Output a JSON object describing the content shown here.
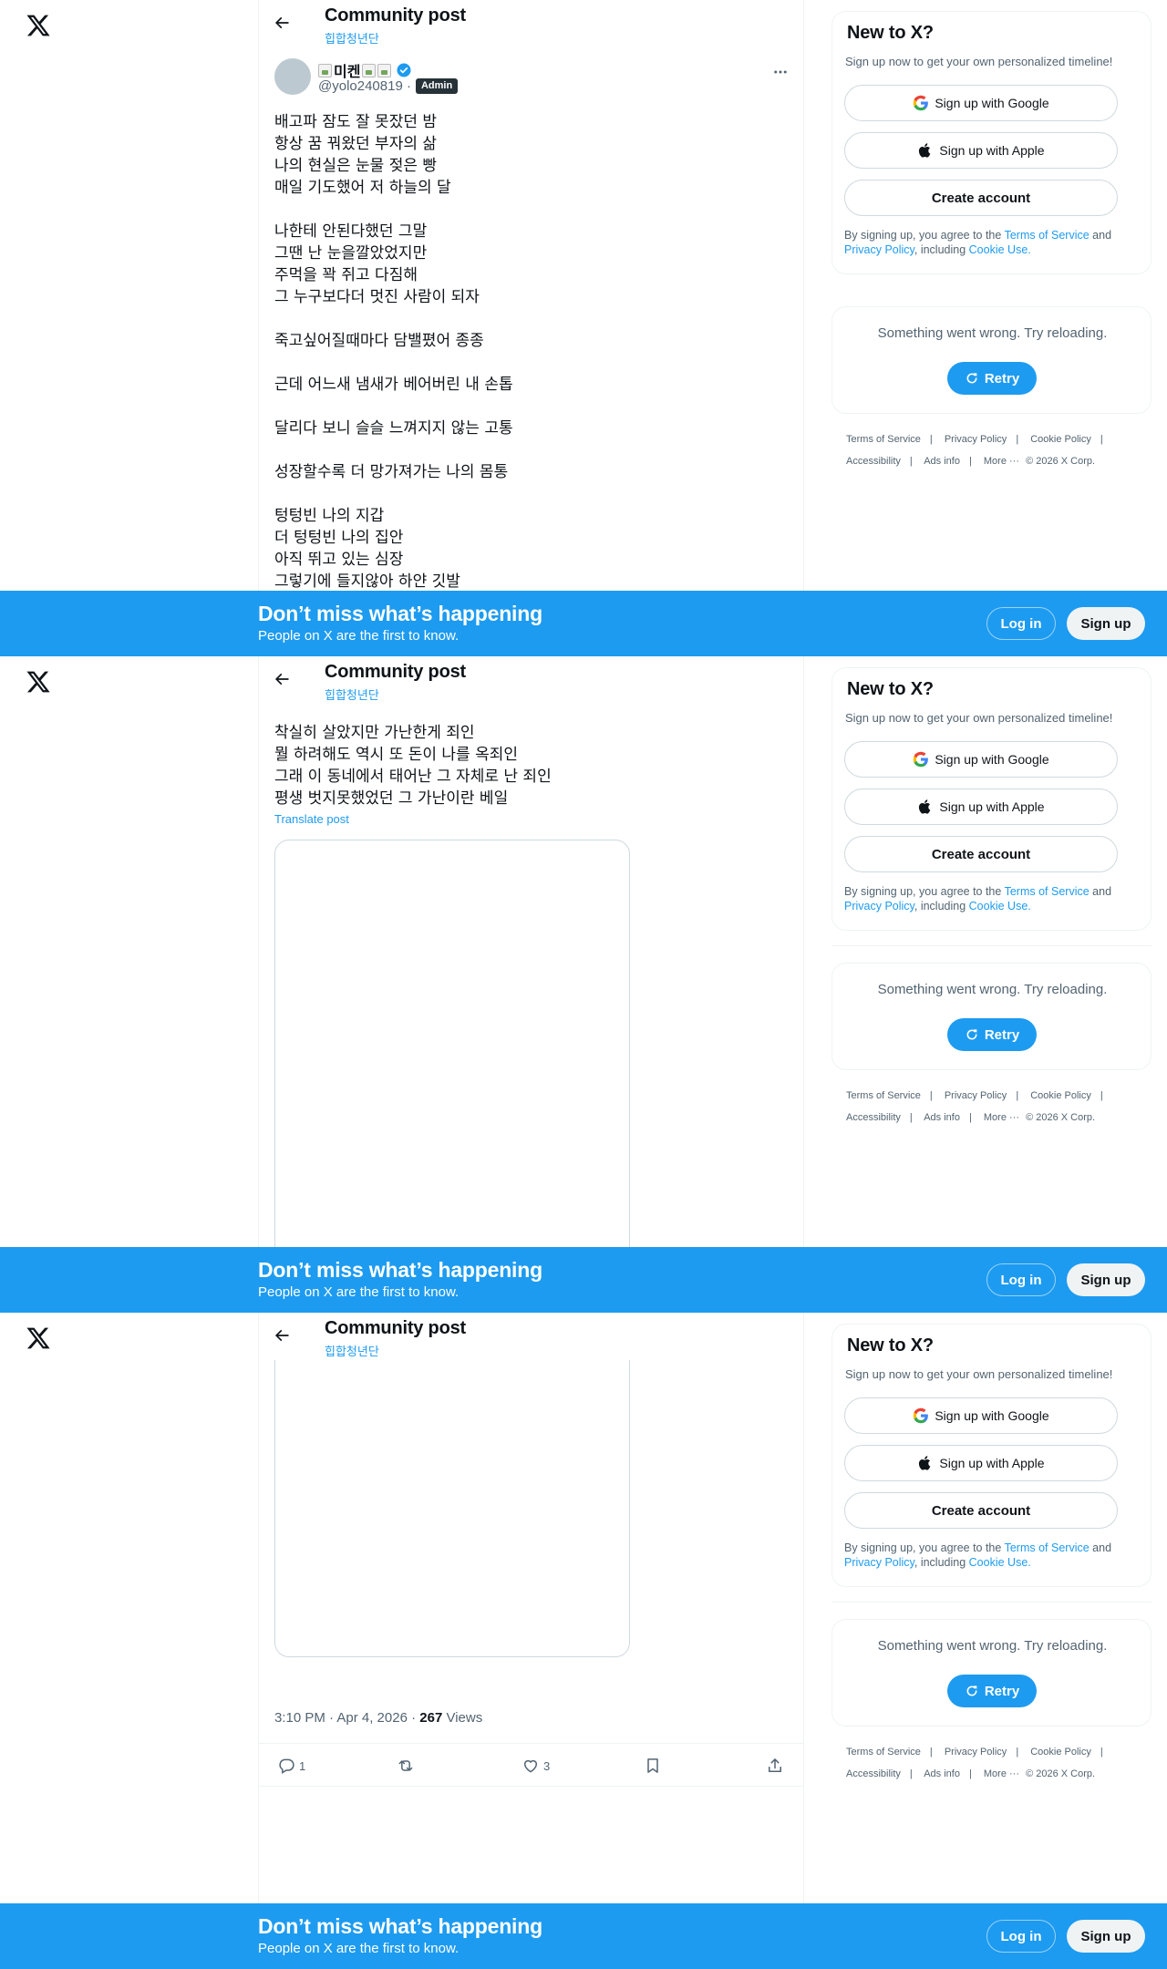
{
  "header": {
    "title": "Community post",
    "community": "힙합청년단",
    "brand": "X"
  },
  "post": {
    "display_name": "미켄",
    "handle": "@yolo240819 ·",
    "badge": "Admin",
    "lines_part1": [
      "배고파 잠도 잘 못잤던 밤",
      "항상 꿈 꿔왔던 부자의 삶",
      "나의 현실은 눈물 젖은 빵",
      "매일 기도했어 저 하늘의 달",
      "",
      "나한테 안된다했던 그말",
      "그땐 난 눈을깔았었지만",
      "주먹을 꽉 쥐고 다짐해",
      "그 누구보다더 멋진 사람이 되자",
      "",
      "죽고싶어질때마다 담밸폈어 종종",
      "",
      "근데 어느새 냄새가 베어버린 내 손톱",
      "",
      "달리다 보니 슬슬 느껴지지 않는 고통",
      "",
      "성장할수록 더 망가져가는 나의 몸통",
      "",
      "텅텅빈 나의 지갑",
      "더 텅텅빈 나의 집안",
      "아직 뛰고 있는 심장",
      "그렇기에 들지않아 하얀 깃발"
    ],
    "lines_part2": [
      "착실히 살았지만 가난한게 죄인",
      "뭘 하려해도 역시 또 돈이 나를 옥죄인",
      "그래 이 동네에서 태어난 그 자체로 난 죄인",
      "평생 벗지못했었던 그 가난이란 베일"
    ],
    "translate": "Translate post",
    "time": "3:10 PM · Apr 4, 2026 ·",
    "views_count": "267",
    "views_label": "Views",
    "replies": "1",
    "likes": "3"
  },
  "sidebar": {
    "new_title": "New to X?",
    "new_sub": "Sign up now to get your own personalized timeline!",
    "google": "Sign up with Google",
    "apple": "Sign up with Apple",
    "create": "Create account",
    "legal_prefix": "By signing up, you agree to the",
    "terms": "Terms of Service",
    "and": "and",
    "privacy": "Privacy Policy",
    "including": ", including",
    "cookie": "Cookie Use.",
    "error": "Something went wrong. Try reloading.",
    "retry": "Retry",
    "footer": {
      "tos": "Terms of Service",
      "privacy": "Privacy Policy",
      "cookie": "Cookie Policy",
      "accessibility": "Accessibility",
      "ads": "Ads info",
      "more": "More ···",
      "copyright": "© 2026 X Corp."
    }
  },
  "banner": {
    "title": "Don’t miss what’s happening",
    "sub": "People on X are the first to know.",
    "login": "Log in",
    "signup": "Sign up"
  },
  "colors": {
    "accent": "#1d9bf0",
    "text": "#0f1419",
    "muted": "#536471"
  }
}
